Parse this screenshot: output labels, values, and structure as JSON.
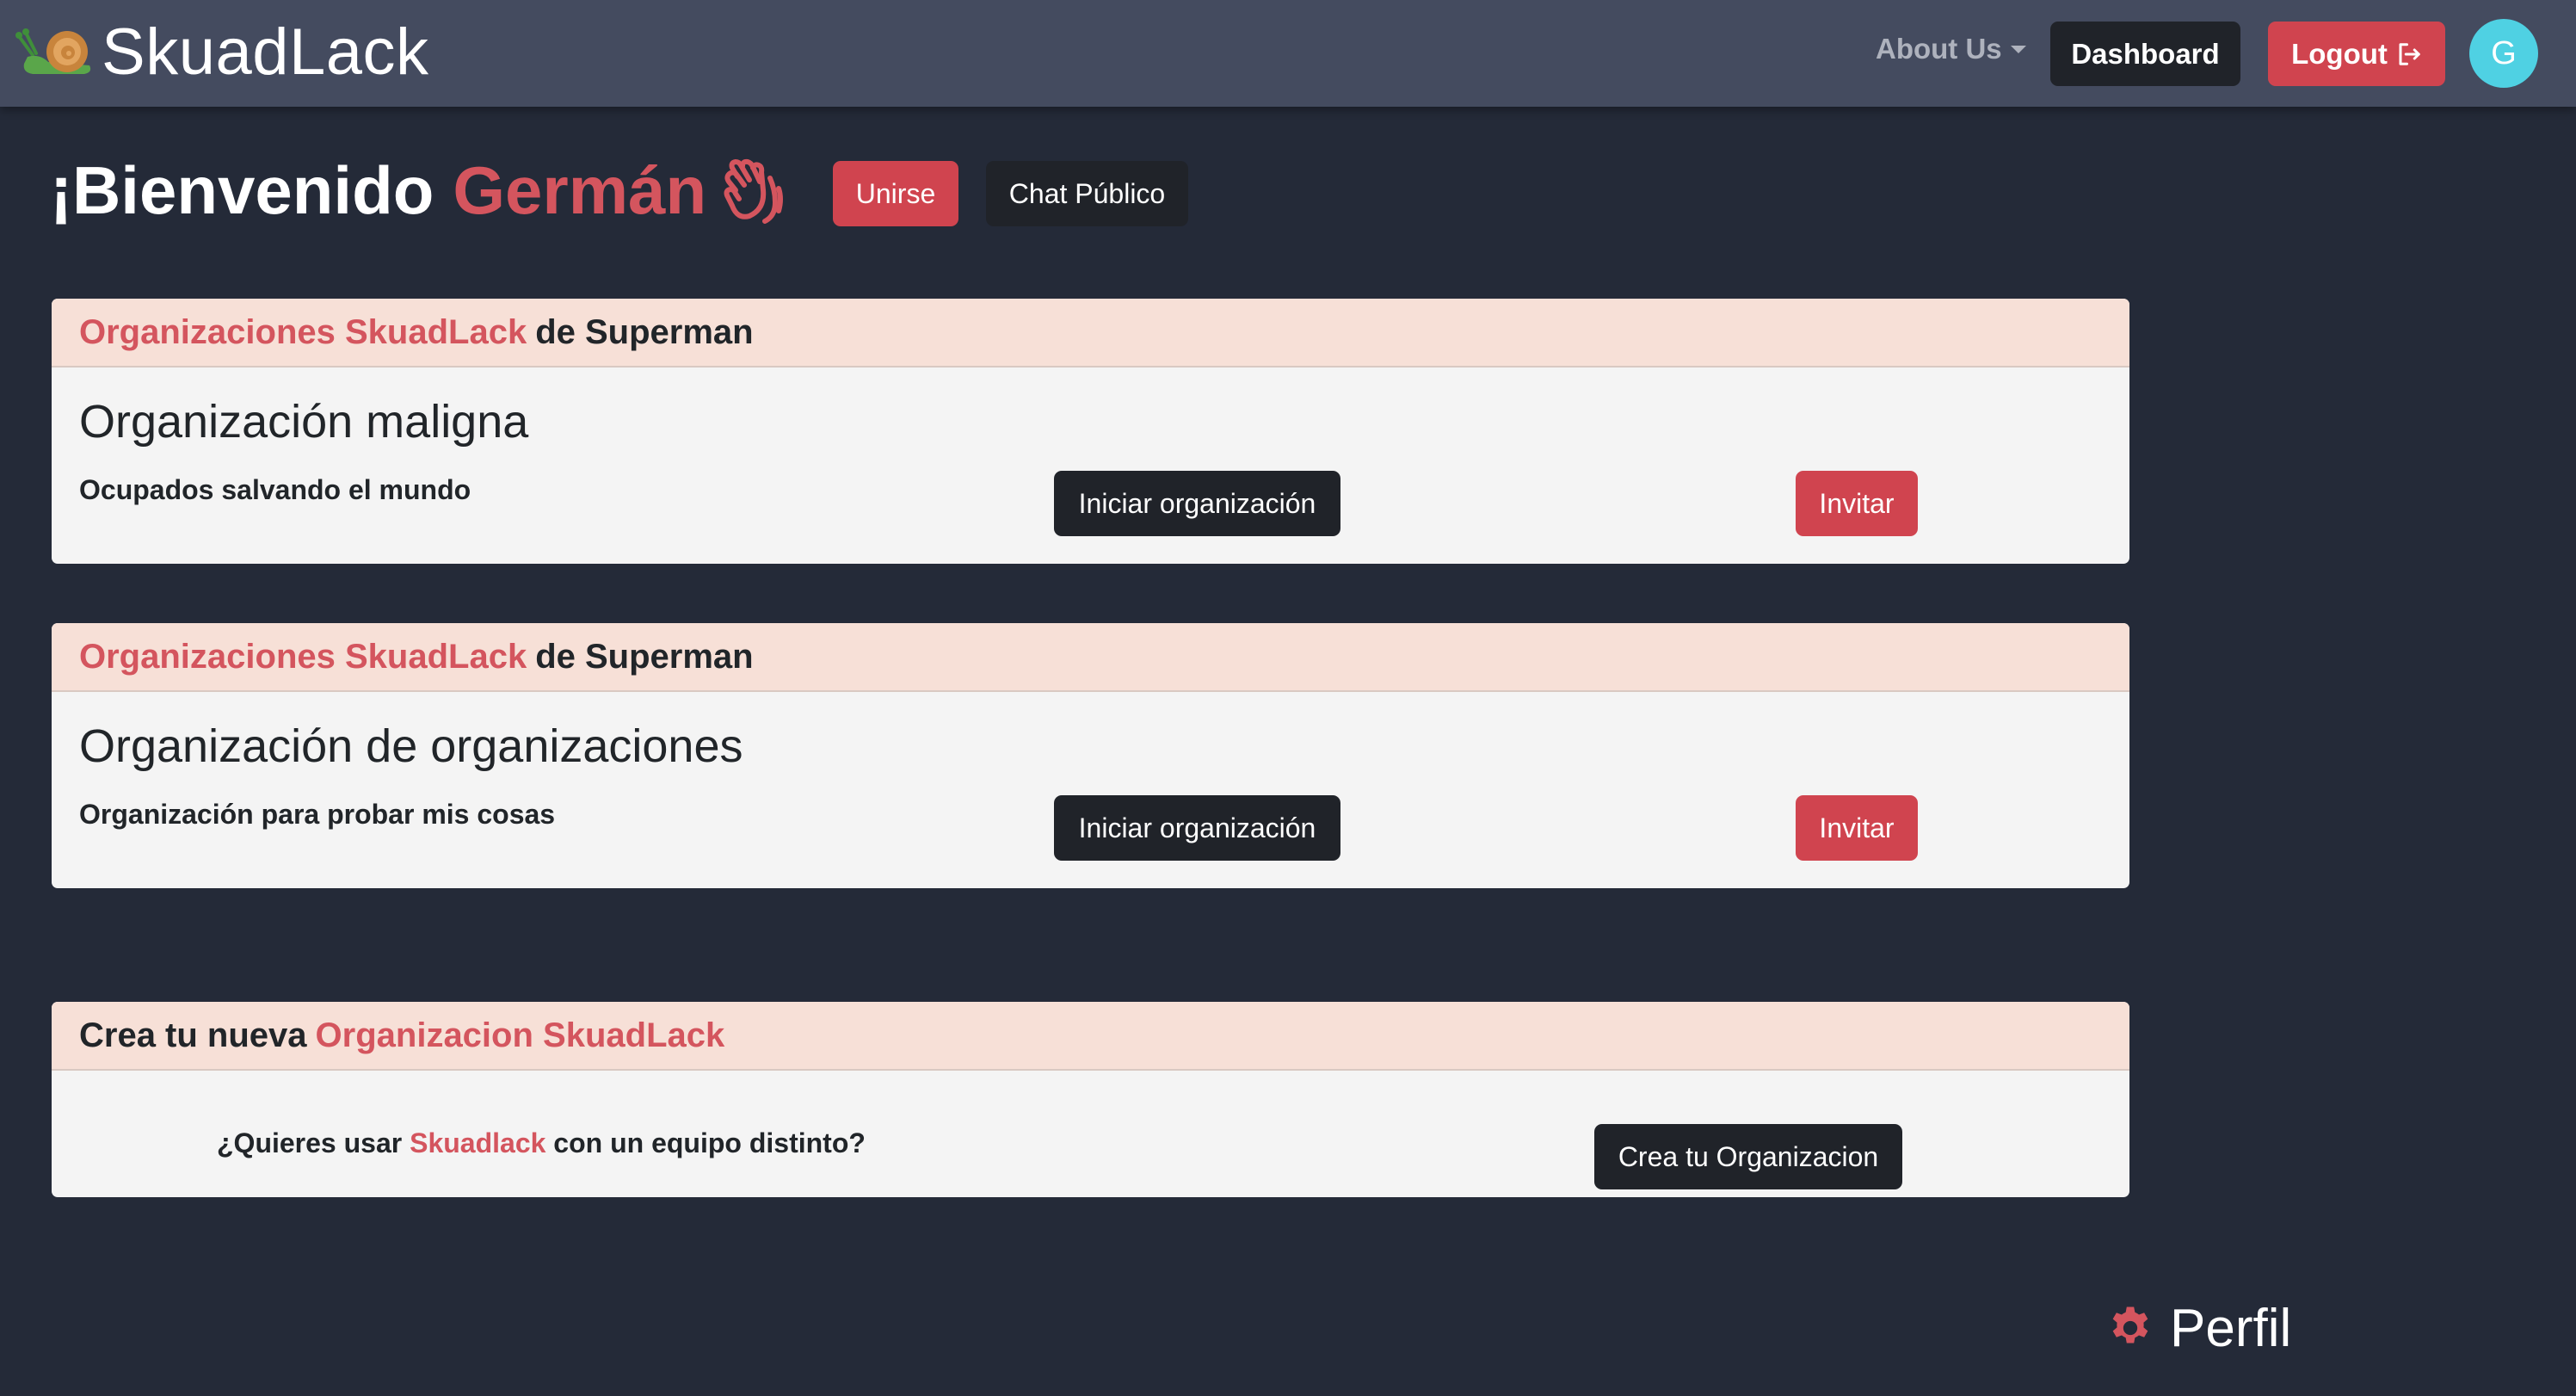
{
  "navbar": {
    "brand": "SkuadLack",
    "about_label": "About Us",
    "dashboard_label": "Dashboard",
    "logout_label": "Logout",
    "avatar_initial": "G"
  },
  "welcome": {
    "greeting": "¡Bienvenido",
    "name": "Germán",
    "join_label": "Unirse",
    "public_chat_label": "Chat Público"
  },
  "organizations": [
    {
      "header_highlight": "Organizaciones SkuadLack",
      "header_rest": "de Superman",
      "title": "Organización maligna",
      "subtitle": "Ocupados salvando el mundo",
      "start_label": "Iniciar organización",
      "invite_label": "Invitar"
    },
    {
      "header_highlight": "Organizaciones SkuadLack",
      "header_rest": "de Superman",
      "title": "Organización de organizaciones",
      "subtitle": "Organización para probar mis cosas",
      "start_label": "Iniciar organización",
      "invite_label": "Invitar"
    }
  ],
  "create": {
    "header_prefix": "Crea tu nueva",
    "header_highlight": "Organizacion SkuadLack",
    "question_prefix": "¿Quieres usar",
    "question_highlight": "Skuadlack",
    "question_suffix": "con un equipo distinto?",
    "button_label": "Crea tu Organizacion"
  },
  "profile": {
    "label": "Perfil"
  },
  "colors": {
    "accent_red": "#d0444f",
    "dark_button": "#202329",
    "navbar_bg": "#444b5f",
    "page_bg": "#242a38",
    "card_header_bg": "#f7e0d7",
    "avatar_bg": "#4fd1e3"
  },
  "icons": {
    "brand": "snail-icon",
    "logout": "logout-icon",
    "wave": "waving-hands-icon",
    "profile": "gear-icon"
  }
}
